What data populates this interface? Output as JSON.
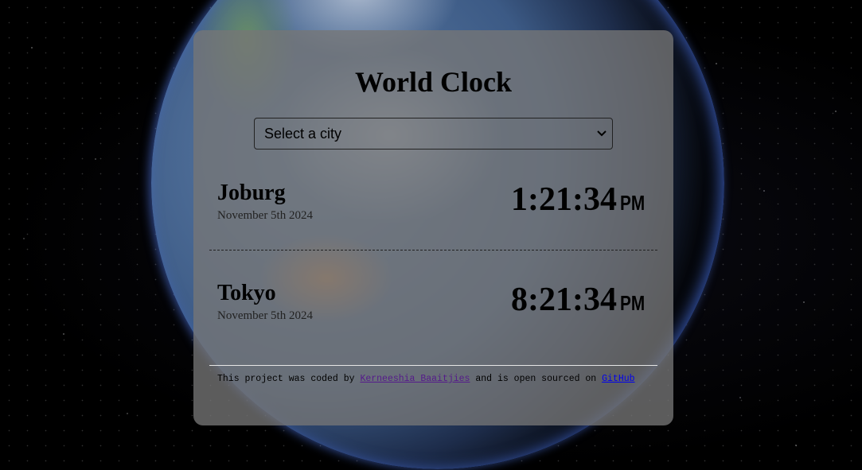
{
  "page": {
    "title": "World Clock"
  },
  "city_select": {
    "selected": "Select a city"
  },
  "cities": [
    {
      "name": "Joburg",
      "date": "November 5th 2024",
      "time": "1:21:34",
      "ampm": "PM"
    },
    {
      "name": "Tokyo",
      "date": "November 5th 2024",
      "time": "8:21:34",
      "ampm": "PM"
    }
  ],
  "footer": {
    "prefix": "This project was coded by ",
    "author": "Kerneeshia Baaitjies",
    "middle": " and is open sourced on ",
    "repo": "GitHub"
  },
  "icons": {
    "select": "chevron-down-icon"
  },
  "colors": {
    "card_bg": "#767676",
    "visited_link": "#551a8b",
    "link": "#0000ee"
  }
}
